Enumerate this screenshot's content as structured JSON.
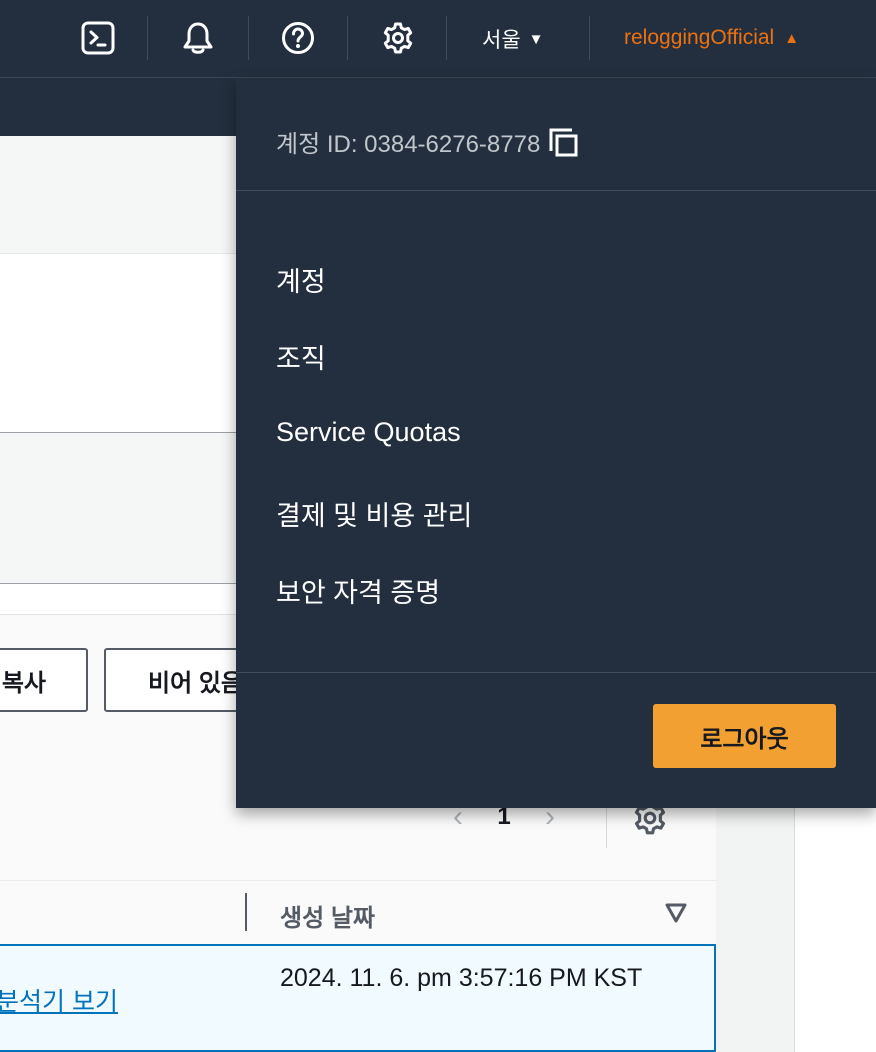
{
  "topnav": {
    "icons": [
      "cloudshell-icon",
      "bell-icon",
      "help-icon",
      "gear-icon"
    ],
    "region_label": "서울",
    "user_label": "reloggingOfficial",
    "colors": {
      "nav_bg": "#232f3e",
      "user": "#ec7211",
      "logout_bg": "#f3a033"
    }
  },
  "dropdown": {
    "account_id_label": "계정 ID: 0384-6276-8778",
    "items": [
      {
        "label": "계정"
      },
      {
        "label": "조직"
      },
      {
        "label": "Service Quotas"
      },
      {
        "label": "결제 및 비용 관리"
      },
      {
        "label": "보안 자격 증명"
      }
    ],
    "logout_label": "로그아웃"
  },
  "background": {
    "copy_button_label": "복사",
    "empty_button_label": "비어 있음",
    "page_number": "1",
    "column_header": "생성 날짜",
    "row_link": "분석기 보기",
    "row_date": "2024. 11. 6. pm 3:57:16 PM KST"
  }
}
